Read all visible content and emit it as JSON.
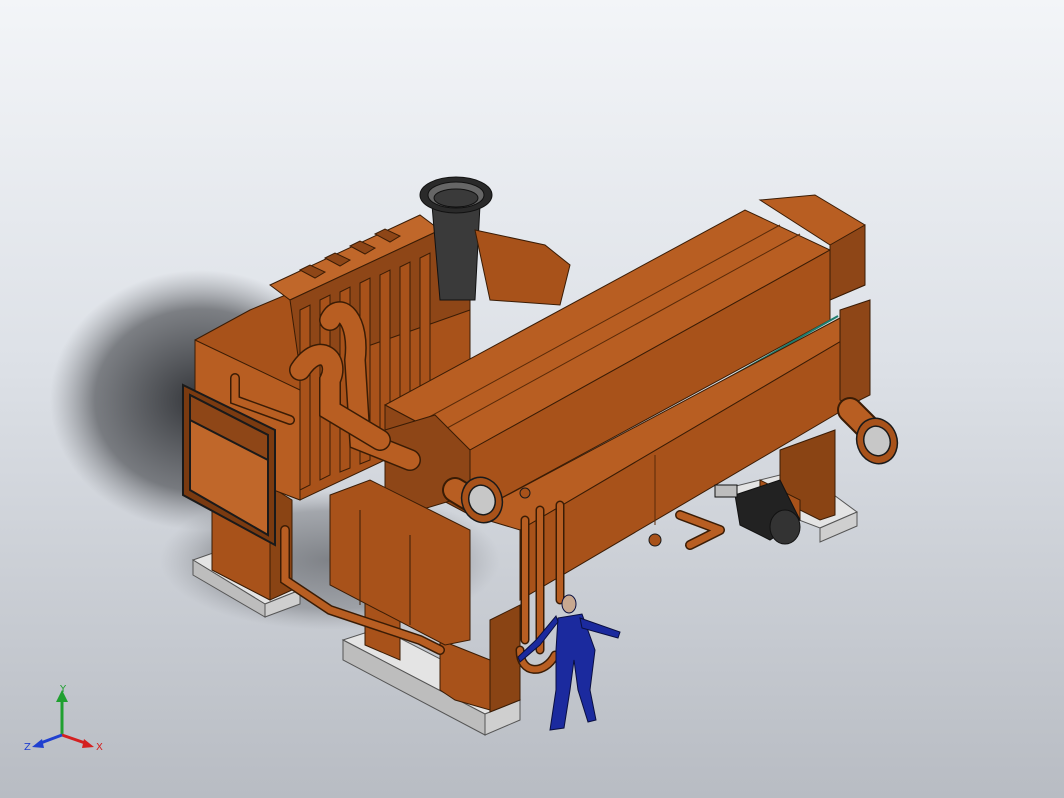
{
  "viewport": {
    "background_top": "#f3f5f8",
    "background_bottom": "#b8bcc3",
    "model_color": "#a8521a",
    "model_dark": "#7a3a10",
    "model_light": "#c0672a",
    "stack_color": "#3a3a3a",
    "base_pad_color": "#e4e4e4",
    "mannequin_color": "#1b2a9e",
    "motor_color": "#222222"
  },
  "triad": {
    "x_label": "X",
    "y_label": "Y",
    "z_label": "Z",
    "x_color": "#d42020",
    "y_color": "#20a030",
    "z_color": "#2040d0"
  }
}
